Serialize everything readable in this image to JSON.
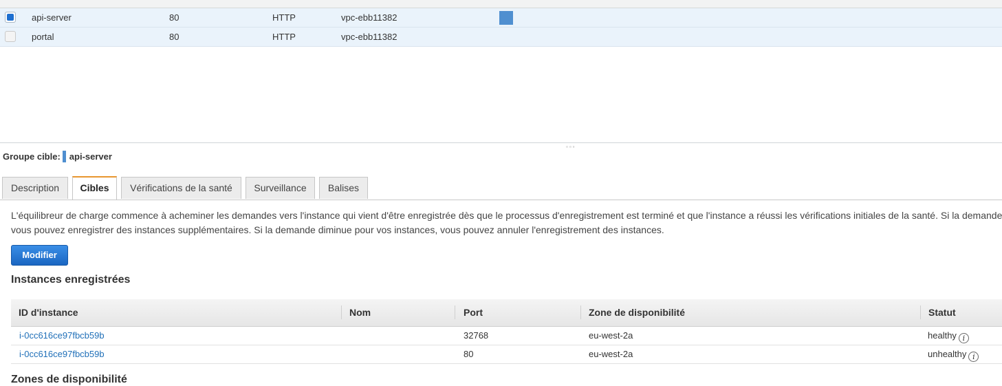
{
  "target_groups": [
    {
      "name": "api-server",
      "port": "80",
      "protocol": "HTTP",
      "vpc": "vpc-ebb11382",
      "selected": true
    },
    {
      "name": "portal",
      "port": "80",
      "protocol": "HTTP",
      "vpc": "vpc-ebb11382",
      "selected": false
    }
  ],
  "detail": {
    "group_label": "Groupe cible:",
    "group_name": "api-server"
  },
  "tabs": [
    {
      "label": "Description",
      "active": false
    },
    {
      "label": "Cibles",
      "active": true
    },
    {
      "label": "Vérifications de la santé",
      "active": false
    },
    {
      "label": "Surveillance",
      "active": false
    },
    {
      "label": "Balises",
      "active": false
    }
  ],
  "info_text": {
    "line1": "L'équilibreur de charge commence à acheminer les demandes vers l'instance qui vient d'être enregistrée dès que le processus d'enregistrement est terminé et que l'instance a réussi les vérifications initiales de la santé. Si la demande a",
    "line2": "vous pouvez enregistrer des instances supplémentaires. Si la demande diminue pour vos instances, vous pouvez annuler l'enregistrement des instances."
  },
  "modify_button": "Modifier",
  "registered_title": "Instances enregistrées",
  "table": {
    "headers": [
      "ID d'instance",
      "Nom",
      "Port",
      "Zone de disponibilité",
      "Statut"
    ],
    "rows": [
      {
        "id": "i-0cc616ce97fbcb59b",
        "name": "",
        "port": "32768",
        "zone": "eu-west-2a",
        "status": "healthy"
      },
      {
        "id": "i-0cc616ce97fbcb59b",
        "name": "",
        "port": "80",
        "zone": "eu-west-2a",
        "status": "unhealthy"
      }
    ]
  },
  "zones_title": "Zones de disponibilité",
  "icons": {
    "info": "info-icon",
    "resize": "resize-grip-icon"
  },
  "colors": {
    "accent": "#4f8fd0",
    "primary_button": "#1a66c2",
    "active_tab_border": "#e8962e",
    "link": "#1f6fb8"
  }
}
